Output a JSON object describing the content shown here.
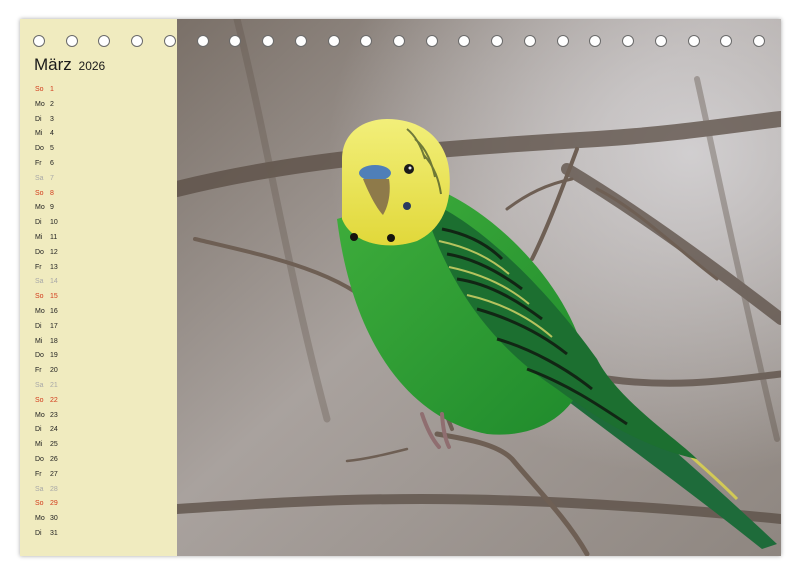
{
  "calendar": {
    "month": "März",
    "year": "2026",
    "days": [
      {
        "wd": "So",
        "d": "1",
        "type": "sun"
      },
      {
        "wd": "Mo",
        "d": "2",
        "type": "wk"
      },
      {
        "wd": "Di",
        "d": "3",
        "type": "wk"
      },
      {
        "wd": "Mi",
        "d": "4",
        "type": "wk"
      },
      {
        "wd": "Do",
        "d": "5",
        "type": "wk"
      },
      {
        "wd": "Fr",
        "d": "6",
        "type": "wk"
      },
      {
        "wd": "Sa",
        "d": "7",
        "type": "sat"
      },
      {
        "wd": "So",
        "d": "8",
        "type": "sun"
      },
      {
        "wd": "Mo",
        "d": "9",
        "type": "wk"
      },
      {
        "wd": "Di",
        "d": "10",
        "type": "wk"
      },
      {
        "wd": "Mi",
        "d": "11",
        "type": "wk"
      },
      {
        "wd": "Do",
        "d": "12",
        "type": "wk"
      },
      {
        "wd": "Fr",
        "d": "13",
        "type": "wk"
      },
      {
        "wd": "Sa",
        "d": "14",
        "type": "sat"
      },
      {
        "wd": "So",
        "d": "15",
        "type": "sun"
      },
      {
        "wd": "Mo",
        "d": "16",
        "type": "wk"
      },
      {
        "wd": "Di",
        "d": "17",
        "type": "wk"
      },
      {
        "wd": "Mi",
        "d": "18",
        "type": "wk"
      },
      {
        "wd": "Do",
        "d": "19",
        "type": "wk"
      },
      {
        "wd": "Fr",
        "d": "20",
        "type": "wk"
      },
      {
        "wd": "Sa",
        "d": "21",
        "type": "sat"
      },
      {
        "wd": "So",
        "d": "22",
        "type": "sun"
      },
      {
        "wd": "Mo",
        "d": "23",
        "type": "wk"
      },
      {
        "wd": "Di",
        "d": "24",
        "type": "wk"
      },
      {
        "wd": "Mi",
        "d": "25",
        "type": "wk"
      },
      {
        "wd": "Do",
        "d": "26",
        "type": "wk"
      },
      {
        "wd": "Fr",
        "d": "27",
        "type": "wk"
      },
      {
        "wd": "Sa",
        "d": "28",
        "type": "sat"
      },
      {
        "wd": "So",
        "d": "29",
        "type": "sun"
      },
      {
        "wd": "Mo",
        "d": "30",
        "type": "wk"
      },
      {
        "wd": "Di",
        "d": "31",
        "type": "wk"
      }
    ]
  },
  "colors": {
    "sidebar_bg": "#f0ebbf",
    "sunday": "#d23a1a",
    "saturday": "#a8a8a8",
    "weekday": "#222222"
  },
  "binding_hole_count": 23,
  "photo_subject": "green budgerigar perched on branch"
}
